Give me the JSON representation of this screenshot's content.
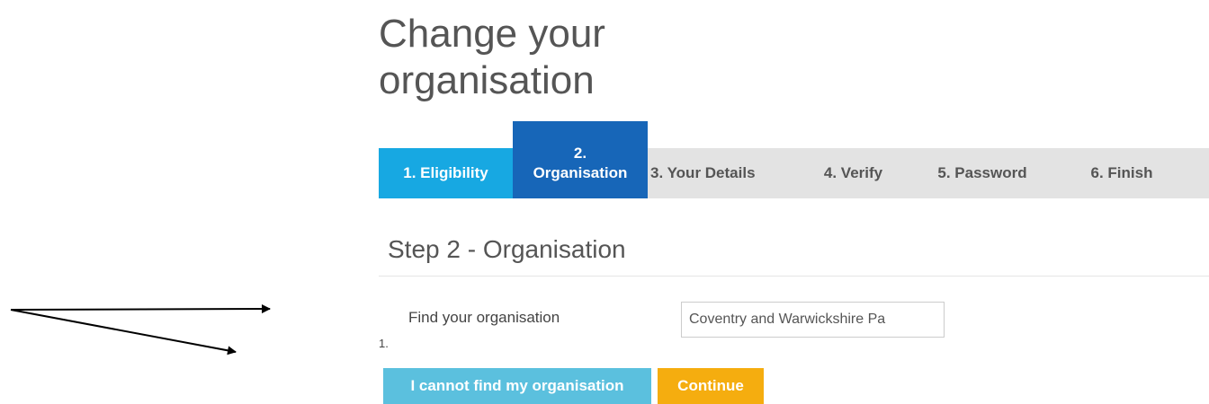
{
  "page": {
    "title": "Change your organisation"
  },
  "steps": [
    {
      "label": "1. Eligibility",
      "state": "complete"
    },
    {
      "number": "2.",
      "label": "Organisation",
      "state": "active"
    },
    {
      "label": "3. Your Details",
      "state": "pending"
    },
    {
      "label": "4. Verify",
      "state": "pending"
    },
    {
      "label": "5. Password",
      "state": "pending"
    },
    {
      "label": "6. Finish",
      "state": "pending"
    }
  ],
  "step_heading": "Step 2 - Organisation",
  "form": {
    "field_label": "Find your organisation",
    "field_value": "Coventry and Warwickshire Pa",
    "list_number": "1."
  },
  "buttons": {
    "cannot_find": "I cannot find my organisation",
    "continue": "Continue"
  },
  "colors": {
    "step_complete": "#17a8e2",
    "step_active": "#1766b8",
    "step_bar": "#e3e3e3",
    "cannot_find_button": "#5bc0de",
    "continue_button": "#f5ad0f"
  },
  "annotations": {
    "arrows": 2
  }
}
